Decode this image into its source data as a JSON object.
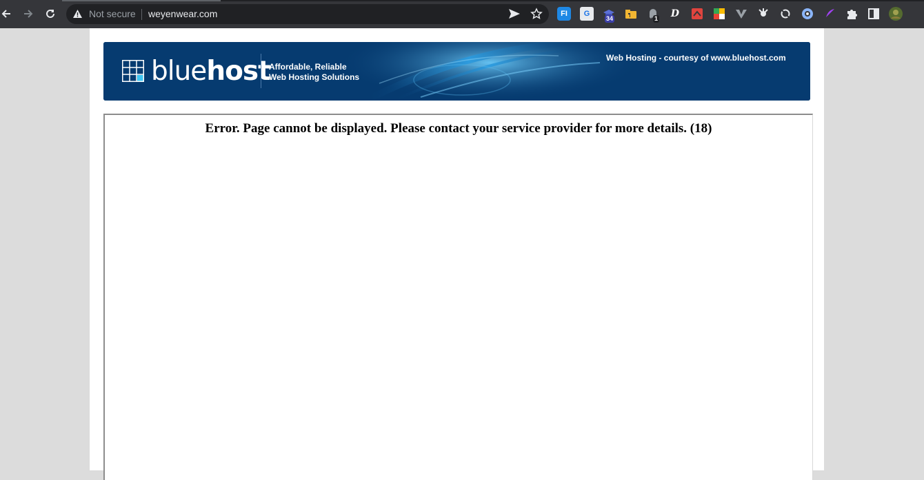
{
  "browser": {
    "security_label": "Not secure",
    "url": "weyenwear.com",
    "extensions": [
      {
        "name": "fi-extension-icon",
        "glyph": "FI"
      },
      {
        "name": "google-translate-icon",
        "glyph": "G"
      },
      {
        "name": "hat-extension-icon",
        "badge": "34"
      },
      {
        "name": "folder-extension-icon",
        "glyph": ""
      },
      {
        "name": "ghost-extension-icon",
        "badge": "1"
      },
      {
        "name": "d-extension-icon",
        "glyph": "D"
      }
    ]
  },
  "banner": {
    "logo_light": "blue",
    "logo_bold": "host",
    "tagline_line1": "Affordable, Reliable",
    "tagline_line2": "Web Hosting Solutions",
    "courtesy": "Web Hosting - courtesy of www.bluehost.com"
  },
  "content": {
    "error_message": "Error. Page cannot be displayed. Please contact your service provider for more details. (18)"
  },
  "colors": {
    "toolbar": "#35363a",
    "banner": "#063b70",
    "page_background": "#dcdcdc"
  }
}
